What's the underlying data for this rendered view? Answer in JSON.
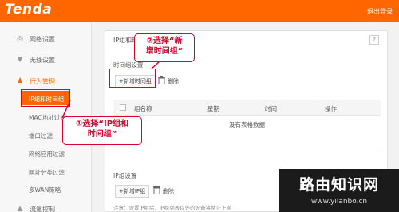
{
  "header": {
    "logo": "Tenda",
    "logout": "退出登录"
  },
  "sidebar": {
    "items": [
      {
        "label": "网络设置",
        "icon": "globe-icon"
      },
      {
        "label": "无线设置",
        "icon": "wifi-icon"
      },
      {
        "label": "行为管理",
        "icon": "user-icon"
      }
    ],
    "sub_items": [
      {
        "label": "IP组和时间组"
      },
      {
        "label": "MAC地址过滤"
      },
      {
        "label": "端口过滤"
      },
      {
        "label": "网络应用过滤"
      },
      {
        "label": "网址分类过滤"
      },
      {
        "label": "多WAN策略"
      }
    ],
    "bottom_item": {
      "label": "流量控制",
      "icon": "chart-icon"
    }
  },
  "main": {
    "title": "IP组和时间组",
    "help": "?",
    "time_group": {
      "section_title": "时间组设置",
      "add_label": "+新增时间组",
      "delete_label": "删除",
      "columns": [
        "组名称",
        "星期",
        "时间",
        "操作"
      ],
      "empty_text": "没有表格数据"
    },
    "ip_group": {
      "section_title": "IP组设置",
      "add_label": "+新增IP组",
      "delete_label": "删除",
      "note": "注意：设置IP组后，IP组列表以外的设备将禁止上网"
    }
  },
  "annotations": {
    "step2": "②选择“新\n增时间组”",
    "step1": "①选择“IP组和\n时间组”"
  },
  "watermark": {
    "title": "路由知识网",
    "url": "www.yilanbo.cn"
  },
  "colors": {
    "brand": "#ff6600",
    "annotation": "#d9002b"
  }
}
